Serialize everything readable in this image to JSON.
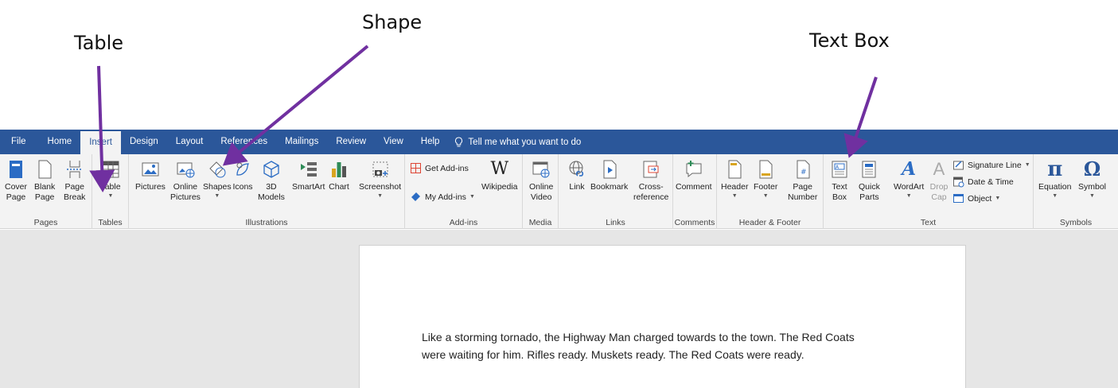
{
  "annotations": {
    "table_label": "Table",
    "shape_label": "Shape",
    "textbox_label": "Text Box",
    "arrow_color": "#7030a0"
  },
  "tabs": [
    "File",
    "Home",
    "Insert",
    "Design",
    "Layout",
    "References",
    "Mailings",
    "Review",
    "View",
    "Help"
  ],
  "active_tab": "Insert",
  "tell_me": "Tell me what you want to do",
  "colors": {
    "accent": "#2b579a",
    "ribbon_bg": "#f3f3f3",
    "workspace_bg": "#e6e6e6"
  },
  "groups": {
    "pages": {
      "label": "Pages",
      "cover_page": [
        "Cover",
        "Page"
      ],
      "blank_page": [
        "Blank",
        "Page"
      ],
      "page_break": [
        "Page",
        "Break"
      ]
    },
    "tables": {
      "label": "Tables",
      "table": "Table"
    },
    "illustrations": {
      "label": "Illustrations",
      "pictures": "Pictures",
      "online_pictures": [
        "Online",
        "Pictures"
      ],
      "shapes": "Shapes",
      "icons": "Icons",
      "models_3d": [
        "3D",
        "Models"
      ],
      "smartart": "SmartArt",
      "chart": "Chart",
      "screenshot": "Screenshot"
    },
    "addins": {
      "label": "Add-ins",
      "get_addins": "Get Add-ins",
      "my_addins": "My Add-ins",
      "wikipedia": "Wikipedia"
    },
    "media": {
      "label": "Media",
      "online_video": [
        "Online",
        "Video"
      ]
    },
    "links": {
      "label": "Links",
      "link": "Link",
      "bookmark": "Bookmark",
      "cross_reference": [
        "Cross-",
        "reference"
      ]
    },
    "comments": {
      "label": "Comments",
      "comment": "Comment"
    },
    "header_footer": {
      "label": "Header & Footer",
      "header": "Header",
      "footer": "Footer",
      "page_number": [
        "Page",
        "Number"
      ]
    },
    "text": {
      "label": "Text",
      "text_box": [
        "Text",
        "Box"
      ],
      "quick_parts": [
        "Quick",
        "Parts"
      ],
      "wordart": "WordArt",
      "drop_cap": [
        "Drop",
        "Cap"
      ],
      "signature_line": "Signature Line",
      "date_time": "Date & Time",
      "object": "Object"
    },
    "symbols": {
      "label": "Symbols",
      "equation": "Equation",
      "symbol": "Symbol"
    }
  },
  "document": {
    "line1": "Like a storming tornado, the Highway Man charged towards to the town. The Red Coats",
    "line2": "were waiting for him. Rifles ready. Muskets ready. The Red Coats were ready."
  }
}
